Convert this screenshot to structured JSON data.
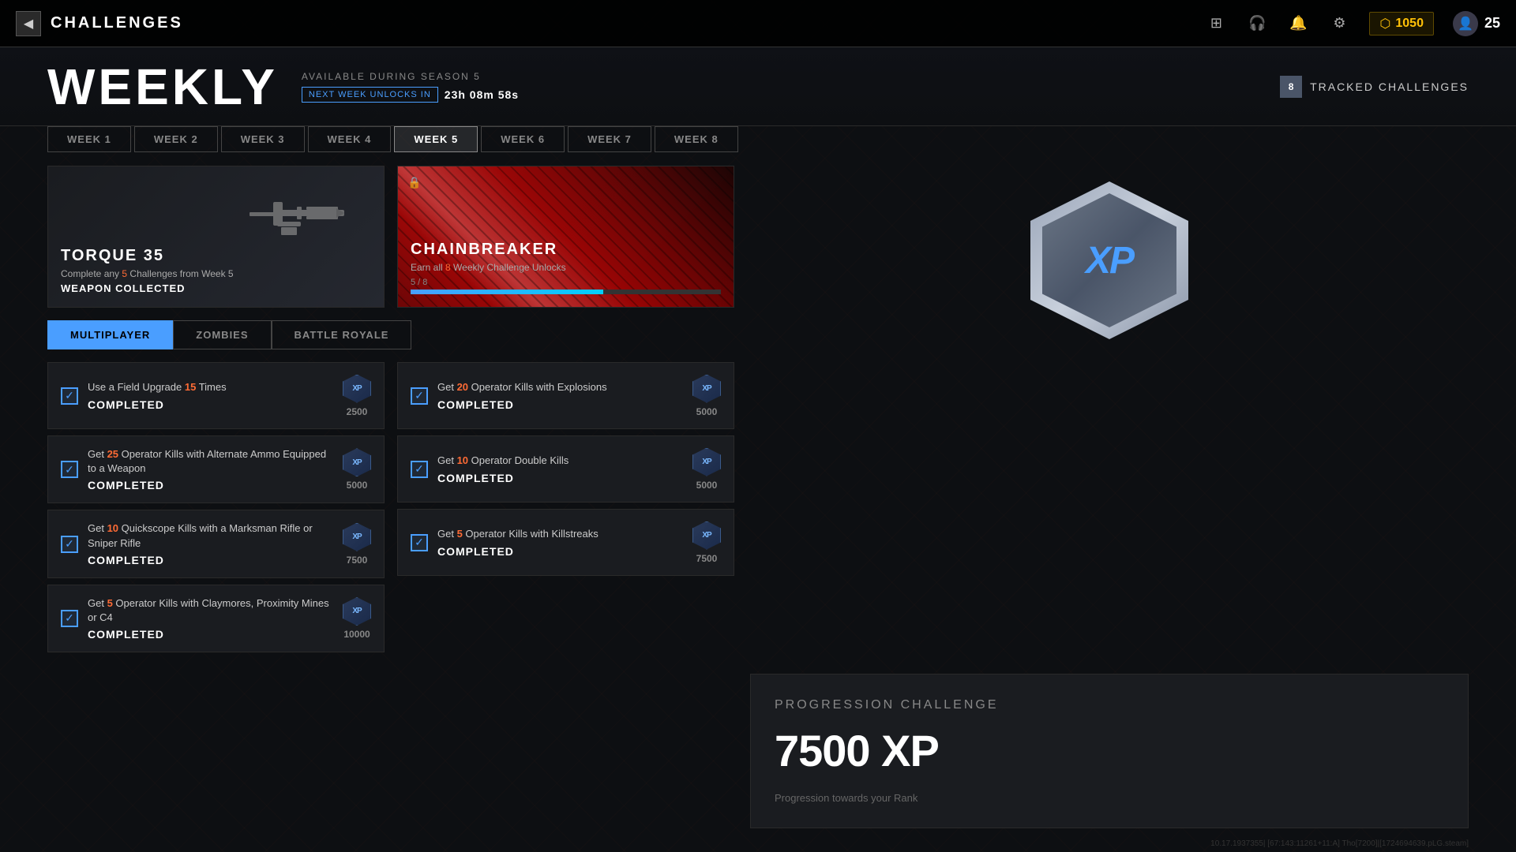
{
  "nav": {
    "back_label": "CHALLENGES",
    "icons": [
      "grid-icon",
      "headset-icon",
      "bell-icon",
      "gear-icon"
    ],
    "currency": {
      "icon": "coin-icon",
      "amount": "1050"
    },
    "level": {
      "icon": "player-icon",
      "number": "25"
    }
  },
  "header": {
    "title": "WEEKLY",
    "available_text": "AVAILABLE DURING SEASON 5",
    "timer_label": "NEXT WEEK UNLOCKS IN",
    "timer_value": "23h 08m 58s",
    "tracked_count": "8",
    "tracked_label": "TRACKED CHALLENGES"
  },
  "week_tabs": [
    {
      "label": "WEEK 1",
      "active": false
    },
    {
      "label": "WEEK 2",
      "active": false
    },
    {
      "label": "WEEK 3",
      "active": false
    },
    {
      "label": "WEEK 4",
      "active": false
    },
    {
      "label": "WEEK 5",
      "active": true
    },
    {
      "label": "WEEK 6",
      "active": false
    },
    {
      "label": "WEEK 7",
      "active": false
    },
    {
      "label": "WEEK 8",
      "active": false
    }
  ],
  "reward_cards": [
    {
      "name": "TORQUE 35",
      "description_prefix": "Complete any ",
      "description_highlight": "5",
      "description_suffix": " Challenges from Week 5",
      "status": "WEAPON COLLECTED",
      "type": "weapon"
    },
    {
      "name": "CHAINBREAKER",
      "description_prefix": "Earn all ",
      "description_highlight": "8",
      "description_suffix": " Weekly Challenge Unlocks",
      "progress_current": "5",
      "progress_total": "8",
      "progress_percent": 62,
      "type": "skin"
    }
  ],
  "mode_tabs": [
    {
      "label": "MULTIPLAYER",
      "active": true
    },
    {
      "label": "ZOMBIES",
      "active": false
    },
    {
      "label": "BATTLE ROYALE",
      "active": false
    }
  ],
  "challenges": {
    "left": [
      {
        "desc_prefix": "Use a Field Upgrade ",
        "desc_highlight": "15",
        "desc_suffix": " Times",
        "status": "COMPLETED",
        "xp": "2500",
        "completed": true
      },
      {
        "desc_prefix": "Get ",
        "desc_highlight": "25",
        "desc_suffix": " Operator Kills with Alternate Ammo Equipped to a Weapon",
        "status": "COMPLETED",
        "xp": "5000",
        "completed": true
      },
      {
        "desc_prefix": "Get ",
        "desc_highlight": "10",
        "desc_suffix": " Quickscope Kills with a Marksman Rifle or Sniper Rifle",
        "status": "COMPLETED",
        "xp": "7500",
        "completed": true
      },
      {
        "desc_prefix": "Get ",
        "desc_highlight": "5",
        "desc_suffix": " Operator Kills with Claymores, Proximity Mines or C4",
        "status": "COMPLETED",
        "xp": "10000",
        "completed": true
      }
    ],
    "right": [
      {
        "desc_prefix": "Get ",
        "desc_highlight": "20",
        "desc_suffix": " Operator Kills with Explosions",
        "status": "COMPLETED",
        "xp": "5000",
        "completed": true
      },
      {
        "desc_prefix": "Get ",
        "desc_highlight": "10",
        "desc_suffix": " Operator Double Kills",
        "status": "COMPLETED",
        "xp": "5000",
        "completed": true
      },
      {
        "desc_prefix": "Get ",
        "desc_highlight": "5",
        "desc_suffix": " Operator Kills with Killstreaks",
        "status": "COMPLETED",
        "xp": "7500",
        "completed": true
      }
    ]
  },
  "xp_badge": {
    "text": "XP"
  },
  "progression": {
    "title": "PROGRESSION CHALLENGE",
    "xp_amount": "7500 XP",
    "description": "Progression towards your Rank"
  },
  "debug": "10.17.1937355| [67:143:11261+11:A] Tho[7200]|[1724694639.pLG.steam]"
}
